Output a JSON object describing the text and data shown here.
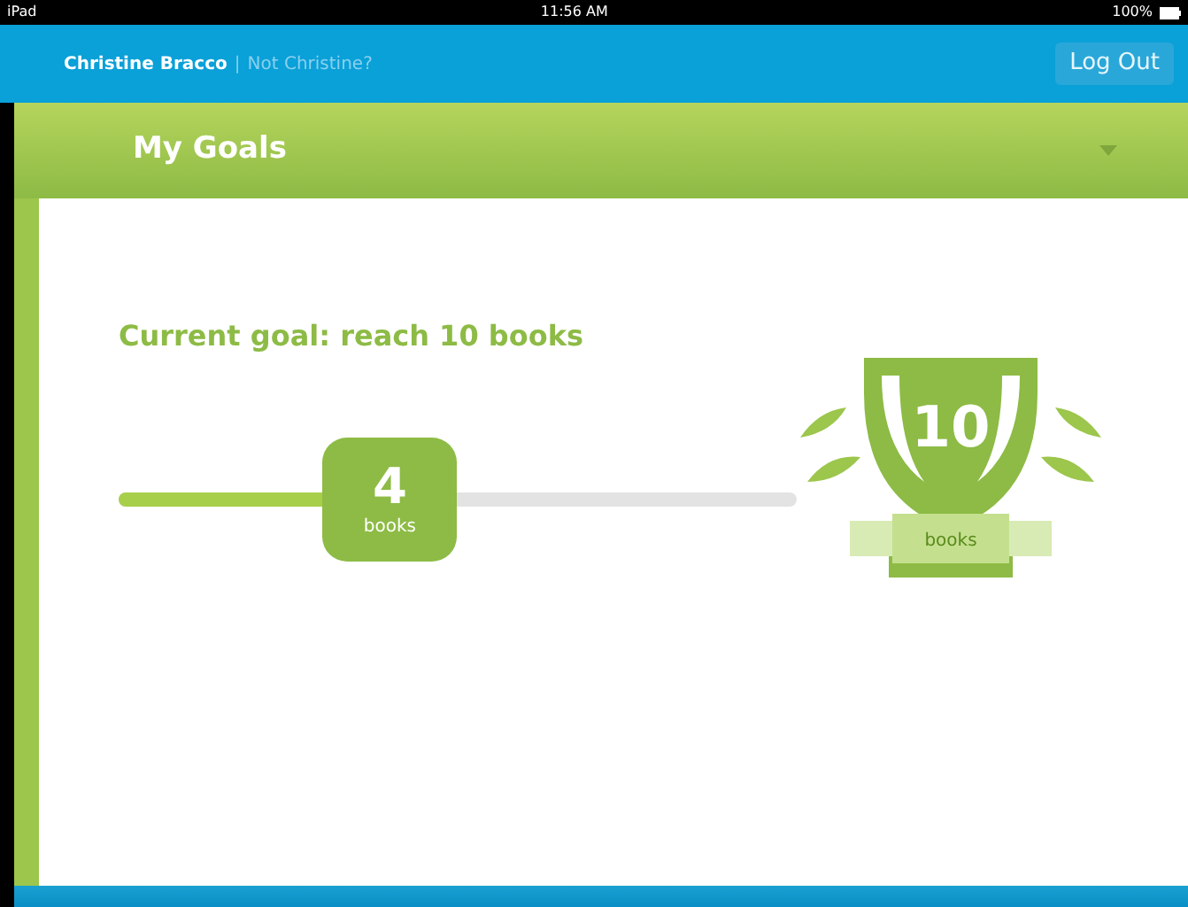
{
  "status_bar": {
    "device": "iPad",
    "time": "11:56 AM",
    "battery": "100%"
  },
  "header": {
    "user": "Christine Bracco",
    "separator": "|",
    "switch_link": "Not Christine?",
    "logout": "Log Out"
  },
  "section": {
    "title": "My Goals",
    "expanded": true
  },
  "goal": {
    "text": "Current goal: reach 10 books",
    "progress": {
      "level": 0.4,
      "count": "4",
      "unit": "books"
    },
    "trophy": {
      "count": "10",
      "unit": "books"
    }
  }
}
